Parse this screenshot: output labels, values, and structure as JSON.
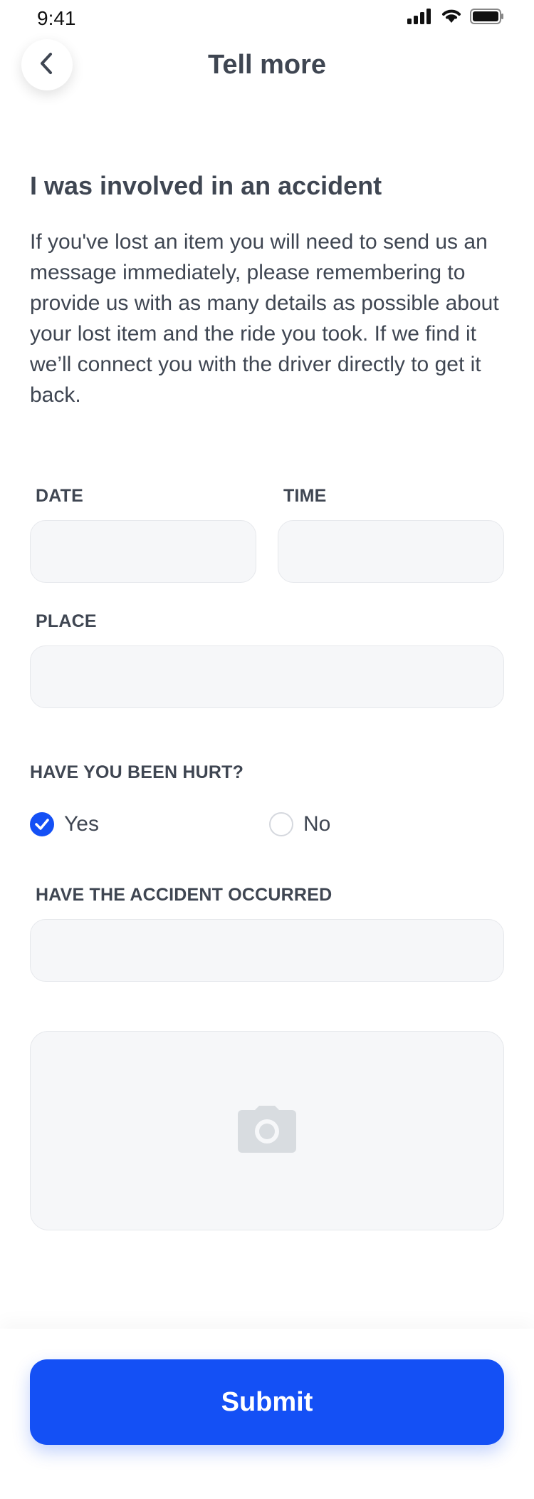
{
  "status_bar": {
    "time": "9:41"
  },
  "header": {
    "title": "Tell more"
  },
  "content": {
    "heading": "I was involved in an accident",
    "description": "If you've lost an item you will need to send us an message immediately, please remembering to provide us with as many details as possible about your lost item and the ride you took. If we find it we’ll connect you with the driver directly to get it back."
  },
  "form": {
    "date_label": "DATE",
    "date_value": "",
    "time_label": "TIME",
    "time_value": "",
    "place_label": "PLACE",
    "place_value": "",
    "hurt_question": "HAVE YOU BEEN HURT?",
    "hurt_options": [
      {
        "label": "Yes",
        "checked": true
      },
      {
        "label": "No",
        "checked": false
      }
    ],
    "occurred_label": "HAVE THE ACCIDENT OCCURRED",
    "occurred_value": ""
  },
  "actions": {
    "submit_label": "Submit"
  },
  "colors": {
    "accent": "#1450f5",
    "text": "#3f4652",
    "field_bg": "#f6f7f9",
    "icon_muted": "#d8dce0"
  }
}
